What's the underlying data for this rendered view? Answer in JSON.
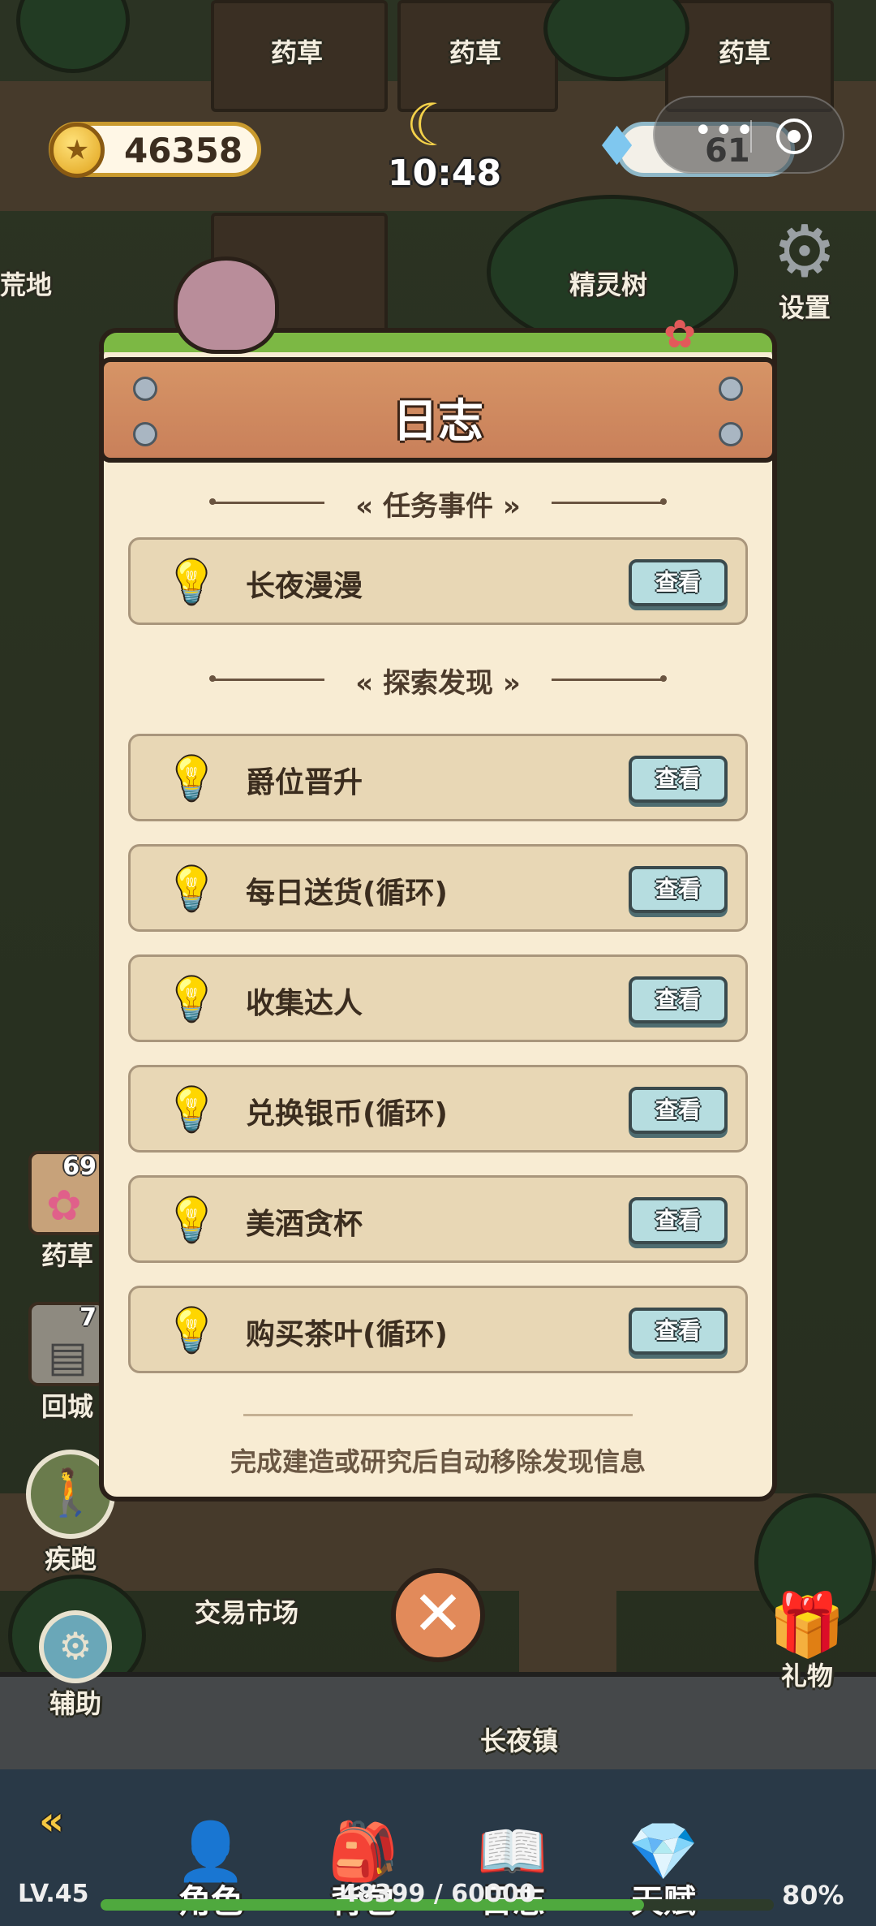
{
  "hud": {
    "coins": "46358",
    "time": "10:48",
    "gems": "61",
    "settings_label": "设置",
    "coin_icon": "star-coin-icon",
    "gem_icon": "diamond-icon"
  },
  "map_labels": {
    "herb1": "药草",
    "herb2": "药草",
    "herb3": "药草",
    "wasteland": "荒地",
    "spirit_tree": "精灵树",
    "market": "交易市场",
    "town": "长夜镇"
  },
  "side": {
    "herb_count": "69",
    "herb_label": "药草",
    "return_count": "7",
    "return_label": "回城",
    "run_label": "疾跑",
    "assist_label": "辅助",
    "gift_label": "礼物"
  },
  "dialog": {
    "title": "日志",
    "section_tasks": "任务事件",
    "section_explore": "探索发现",
    "view_label": "查看",
    "tasks": [
      {
        "title": "长夜漫漫"
      }
    ],
    "discoveries": [
      {
        "title": "爵位晋升"
      },
      {
        "title": "每日送货(循环)"
      },
      {
        "title": "收集达人"
      },
      {
        "title": "兑换银币(循环)"
      },
      {
        "title": "美酒贪杯"
      },
      {
        "title": "购买茶叶(循环)"
      }
    ],
    "footer": "完成建造或研究后自动移除发现信息"
  },
  "bottom": {
    "tabs": [
      "角色",
      "背包",
      "日志",
      "天赋"
    ],
    "level": "LV.45",
    "xp_text": "48399 / 60000",
    "xp_fraction": 0.8067,
    "percent": "80%"
  },
  "colors": {
    "accent_teal": "#b6dde0",
    "plank": "#d69466",
    "panel": "#f8ecd3"
  }
}
